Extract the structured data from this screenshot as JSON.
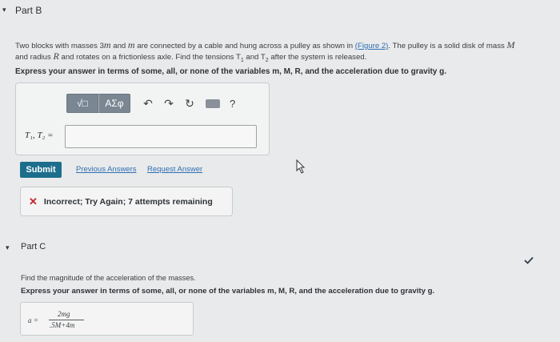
{
  "part_b": {
    "title": "Part B",
    "problem_text_1": "Two blocks with masses 3",
    "problem_var_m": "m",
    "problem_text_2": " and ",
    "problem_text_3": " are connected by a cable and hung across a pulley as shown in ",
    "figure_link": "(Figure 2)",
    "problem_text_4": ". The pulley is a solid disk of mass ",
    "var_M": "M",
    "problem_text_5": "and radius ",
    "var_R": "R",
    "problem_text_6": " and rotates on a frictionless axle. Find the tensions T",
    "sub_1": "1",
    "problem_text_7": " and T",
    "sub_2": "2",
    "problem_text_8": " after the system is released.",
    "instruction": "Express your answer in terms of some, all, or none of the variables m, M, R, and the acceleration due to gravity g.",
    "toolbar": {
      "template_label": "√□",
      "greek_label": "ΑΣφ",
      "undo_icon": "undo-icon",
      "redo_icon": "redo-icon",
      "reset_icon": "reset-icon",
      "keyboard_icon": "keyboard-icon",
      "help_label": "?"
    },
    "answer_label": "T₁, T₂ =",
    "answer_value": "",
    "submit_label": "Submit",
    "previous_answers_label": "Previous Answers",
    "request_answer_label": "Request Answer",
    "feedback_text": "Incorrect; Try Again; 7 attempts remaining"
  },
  "part_c": {
    "title": "Part C",
    "question": "Find the magnitude of the acceleration of the masses.",
    "instruction": "Express your answer in terms of some, all, or none of the variables m, M, R, and the acceleration due to gravity g.",
    "answer_label": "a =",
    "answer_numerator": "2mg",
    "answer_denominator": ".5M+4m"
  },
  "colors": {
    "submit_bg": "#1c6e8c",
    "link": "#2f6fb2",
    "error_x": "#c8232c",
    "check": "#2f6fb2"
  }
}
